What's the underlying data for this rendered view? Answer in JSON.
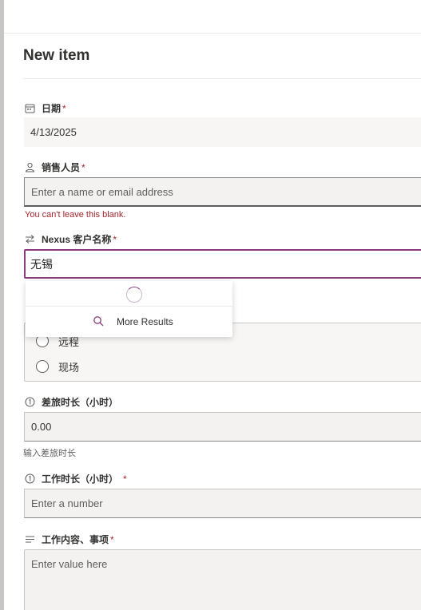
{
  "panel": {
    "title": "New item"
  },
  "fields": {
    "date": {
      "label": "日期",
      "required_mark": "*",
      "value": "4/13/2025"
    },
    "salesperson": {
      "label": "销售人员",
      "required_mark": "*",
      "placeholder": "Enter a name or email address",
      "error": "You can't leave this blank."
    },
    "customer": {
      "label": "Nexus 客户名称",
      "required_mark": "*",
      "value": "无锡"
    },
    "service_type": {
      "options": [
        "远程",
        "现场"
      ]
    },
    "travel_hours": {
      "label": "差旅时长（小时）",
      "value": "0.00",
      "helper": "输入差旅时长"
    },
    "work_hours": {
      "label": "工作时长（小时）",
      "required_mark": "*",
      "placeholder": "Enter a number"
    },
    "work_content": {
      "label": "工作内容、事项",
      "required_mark": "*",
      "placeholder": "Enter value here"
    }
  },
  "dropdown": {
    "more_results_label": "More Results"
  },
  "icons": {
    "date": "calendar-icon",
    "salesperson": "person-icon",
    "customer": "lookup-arrows-icon",
    "travel_hours": "number-icon",
    "work_hours": "number-icon",
    "work_content": "text-lines-icon",
    "search": "search-icon"
  },
  "colors": {
    "accent": "#8a3d7b",
    "error": "#a4262c"
  }
}
